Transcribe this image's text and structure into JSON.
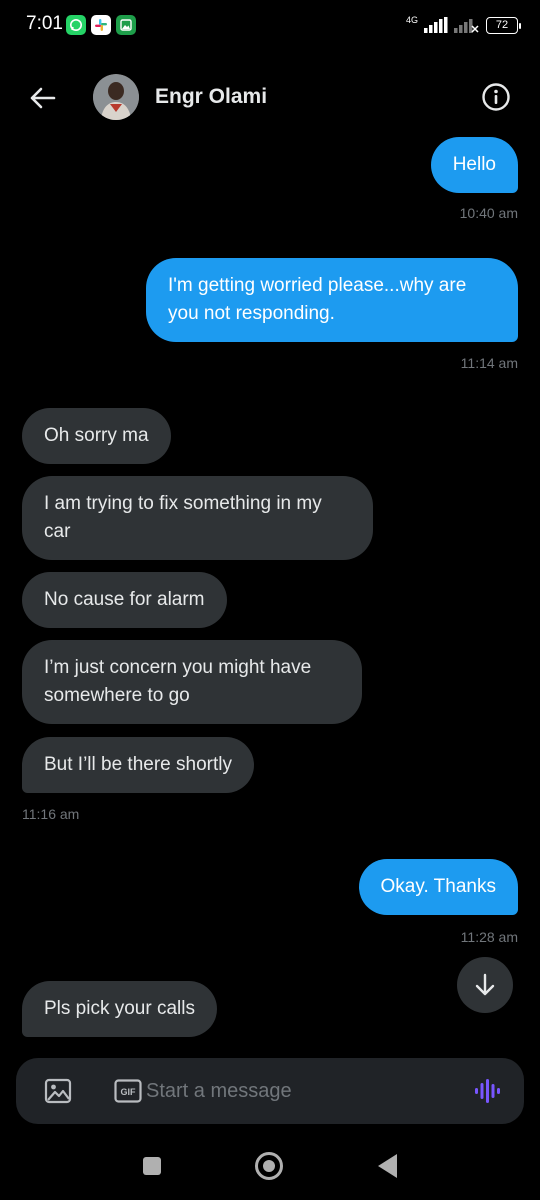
{
  "status_bar": {
    "time": "7:01",
    "network": "4G",
    "battery": "72",
    "icons": [
      "whatsapp-icon",
      "slack-icon",
      "gallery-icon",
      "signal-icon",
      "wifi-off-icon",
      "battery-icon"
    ]
  },
  "header": {
    "contact_name": "Engr Olami"
  },
  "messages": [
    {
      "direction": "sent",
      "text": "Hello"
    },
    {
      "direction": "sent",
      "text": "I'm getting worried please...why are you not responding."
    },
    {
      "direction": "received",
      "text": "Oh sorry ma"
    },
    {
      "direction": "received",
      "text": "I am trying to fix something in my car"
    },
    {
      "direction": "received",
      "text": "No cause for alarm"
    },
    {
      "direction": "received",
      "text": "I’m just concern you might have somewhere to go"
    },
    {
      "direction": "received",
      "text": "But I’ll be there shortly"
    },
    {
      "direction": "sent",
      "text": "Okay. Thanks"
    },
    {
      "direction": "received",
      "text": "Pls pick your calls"
    }
  ],
  "timestamps": {
    "t1": "10:40 am",
    "t2": "11:14 am",
    "t3": "11:16 am",
    "t4": "11:28 am"
  },
  "composer": {
    "placeholder": "Start a message",
    "gif_label": "GIF"
  },
  "colors": {
    "background": "#000000",
    "sent_bubble": "#1d9bf0",
    "received_bubble": "#2f3336",
    "muted_text": "#71767b",
    "voice_accent": "#7856ff"
  }
}
